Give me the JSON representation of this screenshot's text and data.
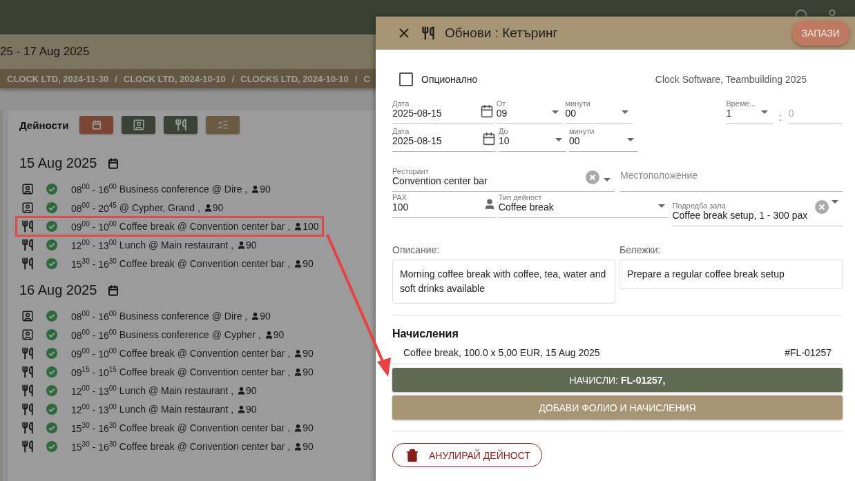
{
  "header": {
    "date_range": "25 - 17 Aug 2025"
  },
  "breadcrumbs": {
    "separator": "/",
    "items": [
      "CLOCK LTD, 2024-11-30",
      "CLOCK LTD, 2024-10-10",
      "CLOCKS LTD, 2024-10-10",
      "C"
    ]
  },
  "activities": {
    "title": "Дейности",
    "filters": [
      {
        "kind": "calendar",
        "color": "#7a4634"
      },
      {
        "kind": "meeting",
        "color": "#3c4235"
      },
      {
        "kind": "catering",
        "color": "#3c4235"
      },
      {
        "kind": "checklist",
        "color": "#6b5b42"
      }
    ],
    "days": [
      {
        "date": "15 Aug 2025",
        "items": [
          {
            "kind": "meeting",
            "confirmed": true,
            "highlighted": false,
            "time": "08$^{00}$ - 16$^{00}$",
            "title": "Business conference @ Dire ,",
            "pax": "90"
          },
          {
            "kind": "meeting",
            "confirmed": true,
            "highlighted": false,
            "time": "08$^{00}$ - 20$^{45}$",
            "title": "@ Cypher, Grand ,",
            "pax": "90"
          },
          {
            "kind": "catering",
            "confirmed": true,
            "highlighted": true,
            "time": "09$^{00}$ - 10$^{00}$",
            "title": "Coffee break @ Convention center bar ,",
            "pax": "100"
          },
          {
            "kind": "catering",
            "confirmed": true,
            "highlighted": false,
            "time": "12$^{00}$ - 13$^{00}$",
            "title": "Lunch @ Main restaurant ,",
            "pax": "90"
          },
          {
            "kind": "catering",
            "confirmed": true,
            "highlighted": false,
            "time": "15$^{30}$ - 16$^{30}$",
            "title": "Coffee break @ Convention center bar ,",
            "pax": "90"
          }
        ]
      },
      {
        "date": "16 Aug 2025",
        "items": [
          {
            "kind": "meeting",
            "confirmed": true,
            "highlighted": false,
            "time": "08$^{00}$ - 16$^{00}$",
            "title": "Business conference @ Dire ,",
            "pax": "90"
          },
          {
            "kind": "meeting",
            "confirmed": true,
            "highlighted": false,
            "time": "08$^{00}$ - 16$^{00}$",
            "title": "Business conference @ Cypher ,",
            "pax": "90"
          },
          {
            "kind": "catering",
            "confirmed": true,
            "highlighted": false,
            "time": "09$^{00}$ - 10$^{00}$",
            "title": "Coffee break @ Convention center bar ,",
            "pax": "90"
          },
          {
            "kind": "catering",
            "confirmed": true,
            "highlighted": false,
            "time": "09$^{15}$ - 10$^{15}$",
            "title": "Coffee break @ Convention center bar ,",
            "pax": "90"
          },
          {
            "kind": "catering",
            "confirmed": true,
            "highlighted": false,
            "time": "12$^{00}$ - 13$^{00}$",
            "title": "Lunch @ Main restaurant ,",
            "pax": "90"
          },
          {
            "kind": "catering",
            "confirmed": true,
            "highlighted": false,
            "time": "12$^{00}$ - 13$^{00}$",
            "title": "Lunch @ Main restaurant ,",
            "pax": "90"
          },
          {
            "kind": "catering",
            "confirmed": true,
            "highlighted": false,
            "time": "15$^{30}$ - 16$^{30}$",
            "title": "Coffee break @ Convention center bar ,",
            "pax": "90"
          },
          {
            "kind": "catering",
            "confirmed": true,
            "highlighted": false,
            "time": "15$^{30}$ - 16$^{30}$",
            "title": "Coffee break @ Convention center bar ,",
            "pax": "90"
          }
        ]
      }
    ]
  },
  "drawer": {
    "title": "Обнови : Кетъринг",
    "save": "ЗАПАЗИ",
    "optional": {
      "label": "Опционално",
      "checked": false
    },
    "event": "Clock Software, Teambuilding 2025",
    "start": {
      "date_label": "Дата",
      "date": "2025-08-15",
      "hour_label": "От",
      "hour": "09",
      "minute_label": "минути",
      "minute": "00"
    },
    "end": {
      "date_label": "Дата",
      "date": "2025-08-15",
      "hour_label": "До",
      "hour": "10",
      "minute_label": "минути",
      "minute": "00"
    },
    "duration": {
      "label": "Време...",
      "hours": "1",
      "separator": ":",
      "minutes": "0"
    },
    "restaurant": {
      "label": "Ресторант",
      "value": "Convention center bar"
    },
    "location": {
      "placeholder": "Местоположение"
    },
    "pax": {
      "label": "PAX",
      "value": "100"
    },
    "activity_type": {
      "label": "Тип дейност",
      "value": "Coffee break"
    },
    "setup": {
      "label": "Подредба зала",
      "value": "Coffee break setup, 1 - 300 pax"
    },
    "description": {
      "label": "Описание:",
      "value": "Morning coffee break with coffee, tea, water and soft drinks available"
    },
    "notes": {
      "label": "Бележки:",
      "value": "Prepare a regular coffee break setup"
    },
    "charges": {
      "title": "Начисления",
      "items": [
        {
          "text": "Coffee break, 100.0 x 5,00 EUR, 15 Aug 2025",
          "folio": "#FL-01257"
        }
      ]
    },
    "charge_button": "НАЧИСЛИ: **FL-01257,**",
    "add_folio_button": "ДОБАВИ ФОЛИО И НАЧИСЛЕНИЯ",
    "cancel_button": "АНУЛИРАЙ ДЕЙНОСТ"
  }
}
